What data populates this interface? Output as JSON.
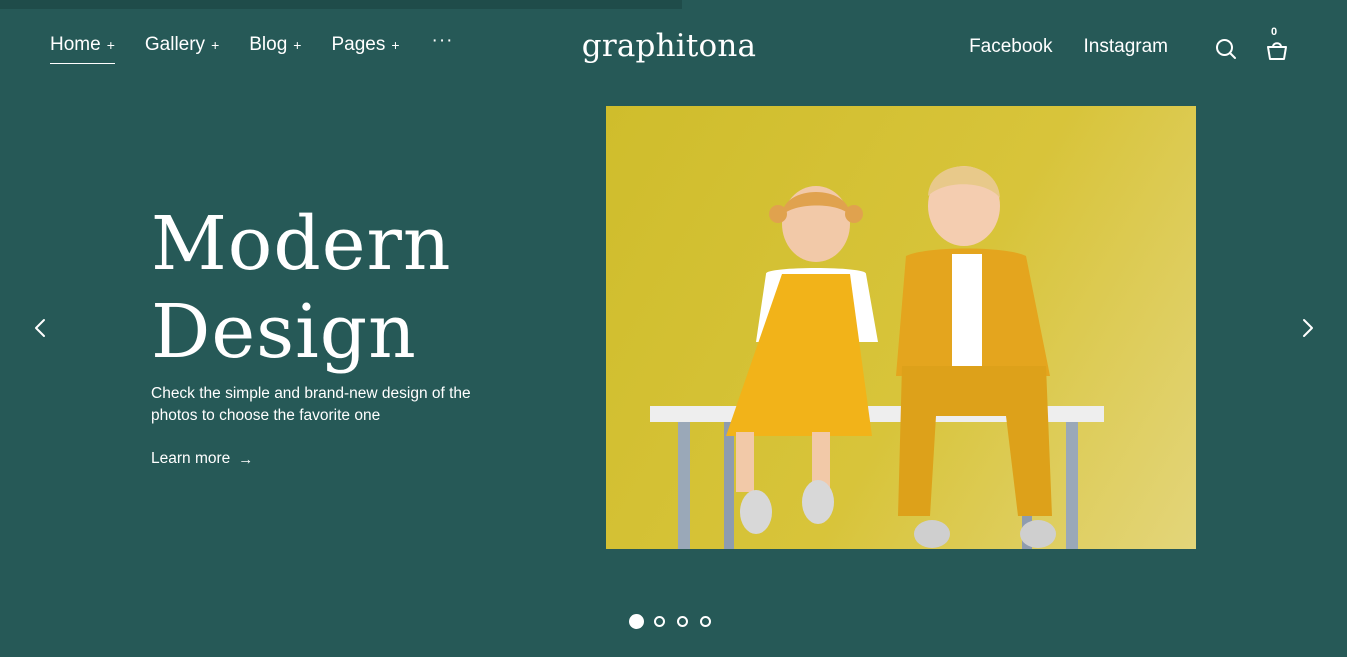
{
  "header": {
    "logo": "graphitona",
    "nav": [
      {
        "label": "Home",
        "suffix": "+"
      },
      {
        "label": "Gallery",
        "suffix": "+"
      },
      {
        "label": "Blog",
        "suffix": "+"
      },
      {
        "label": "Pages",
        "suffix": "+"
      }
    ],
    "more_label": "···",
    "social": [
      {
        "label": "Facebook"
      },
      {
        "label": "Instagram"
      }
    ],
    "cart_count": "0",
    "icons": {
      "search": "search-icon",
      "cart": "shopping-bag-icon",
      "more": "more-dots-icon"
    }
  },
  "hero": {
    "title_line1": "Modern",
    "title_line2": "Design",
    "description": "Check the simple and brand-new design of the photos to choose the favorite one",
    "cta_label": "Learn more",
    "cta_arrow": "→",
    "image_subject": "two children in yellow outfits sitting on a white bench against a yellow wall"
  },
  "slider": {
    "slide_count": 4,
    "active_index": 0
  },
  "colors": {
    "background": "#265957",
    "accent_yellow": "#d4c232",
    "text": "#ffffff"
  }
}
